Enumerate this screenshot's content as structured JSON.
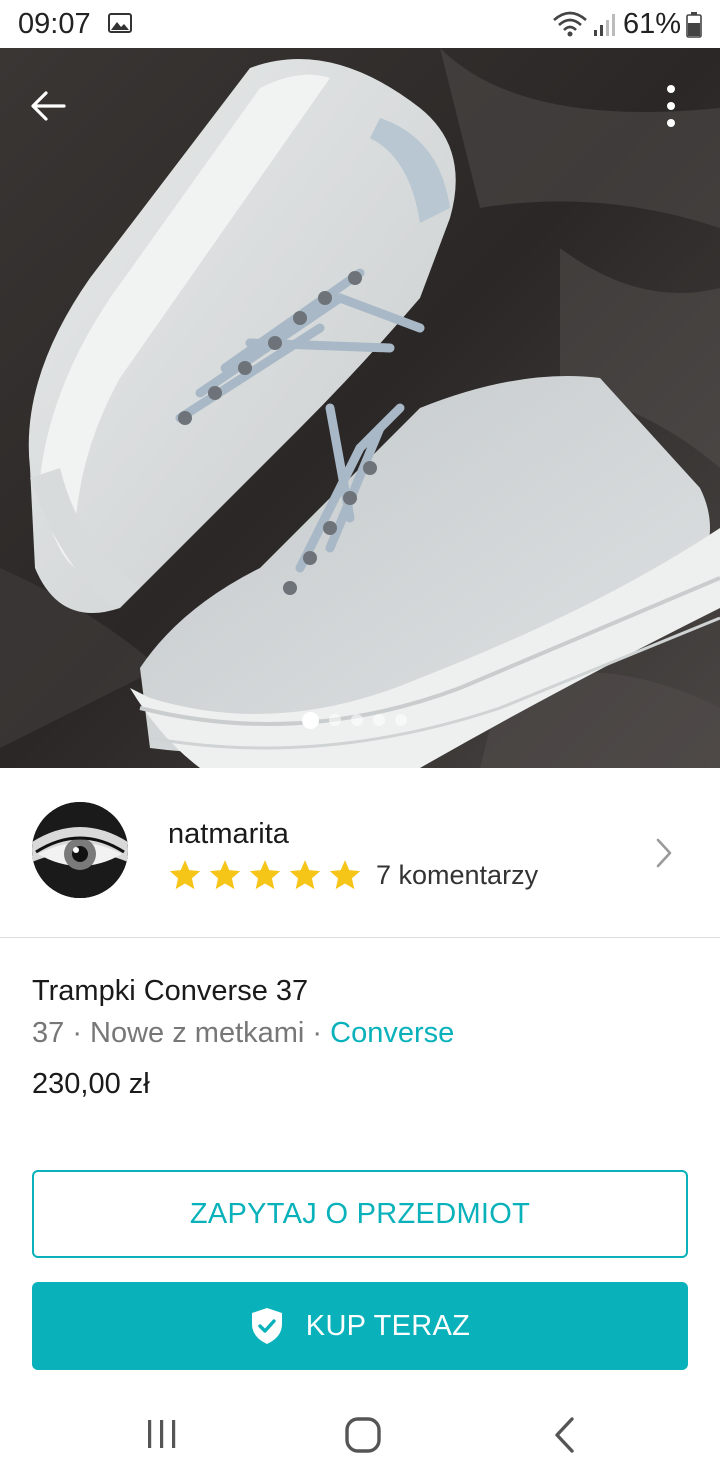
{
  "status_bar": {
    "time": "09:07",
    "battery_percent": "61%"
  },
  "hero": {
    "image_count": 5,
    "active_index": 0,
    "icons": [
      "back-arrow-icon",
      "more-vertical-icon"
    ]
  },
  "seller": {
    "username": "natmarita",
    "rating_stars": 5,
    "reviews_label": "7 komentarzy"
  },
  "item": {
    "title": "Trampki Converse 37",
    "size": "37",
    "separator": " · ",
    "condition": "Nowe z metkami",
    "brand": "Converse",
    "price": "230,00 zł"
  },
  "actions": {
    "ask_label": "ZAPYTAJ O PRZEDMIOT",
    "buy_label": "KUP TERAZ"
  },
  "colors": {
    "accent": "#09b1ba",
    "star": "#f5c518",
    "text": "#1a1a1a",
    "muted": "#777777"
  }
}
